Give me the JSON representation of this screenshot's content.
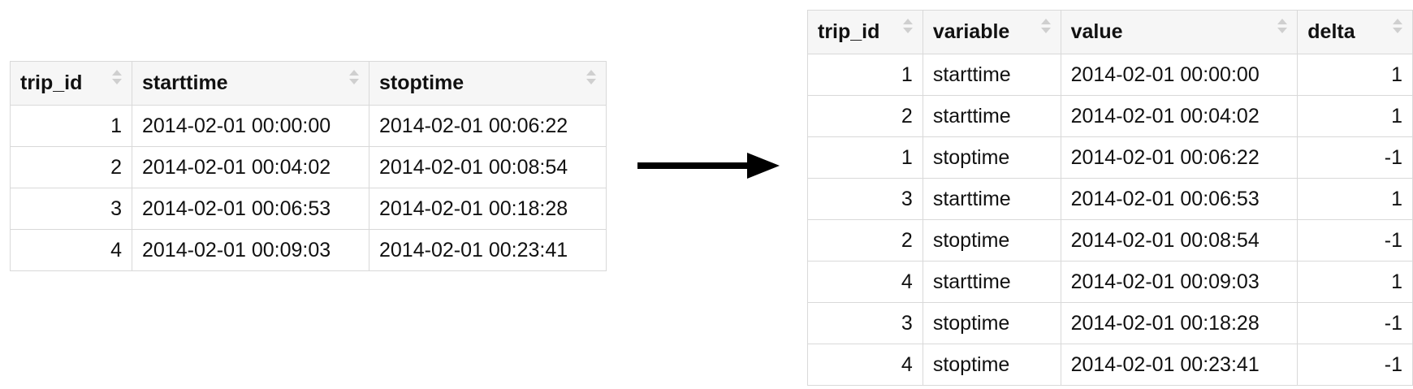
{
  "left_table": {
    "headers": [
      "trip_id",
      "starttime",
      "stoptime"
    ],
    "rows": [
      [
        "1",
        "2014-02-01 00:00:00",
        "2014-02-01 00:06:22"
      ],
      [
        "2",
        "2014-02-01 00:04:02",
        "2014-02-01 00:08:54"
      ],
      [
        "3",
        "2014-02-01 00:06:53",
        "2014-02-01 00:18:28"
      ],
      [
        "4",
        "2014-02-01 00:09:03",
        "2014-02-01 00:23:41"
      ]
    ]
  },
  "right_table": {
    "headers": [
      "trip_id",
      "variable",
      "value",
      "delta"
    ],
    "rows": [
      [
        "1",
        "starttime",
        "2014-02-01 00:00:00",
        "1"
      ],
      [
        "2",
        "starttime",
        "2014-02-01 00:04:02",
        "1"
      ],
      [
        "1",
        "stoptime",
        "2014-02-01 00:06:22",
        "-1"
      ],
      [
        "3",
        "starttime",
        "2014-02-01 00:06:53",
        "1"
      ],
      [
        "2",
        "stoptime",
        "2014-02-01 00:08:54",
        "-1"
      ],
      [
        "4",
        "starttime",
        "2014-02-01 00:09:03",
        "1"
      ],
      [
        "3",
        "stoptime",
        "2014-02-01 00:18:28",
        "-1"
      ],
      [
        "4",
        "stoptime",
        "2014-02-01 00:23:41",
        "-1"
      ]
    ]
  },
  "icons": {
    "sort": "sort-arrows-icon",
    "arrow": "arrow-right-icon"
  },
  "colors": {
    "border": "#d9d9d9",
    "header_bg": "#f6f6f6",
    "sort_icon": "#cfcfcf",
    "arrow": "#000000"
  }
}
